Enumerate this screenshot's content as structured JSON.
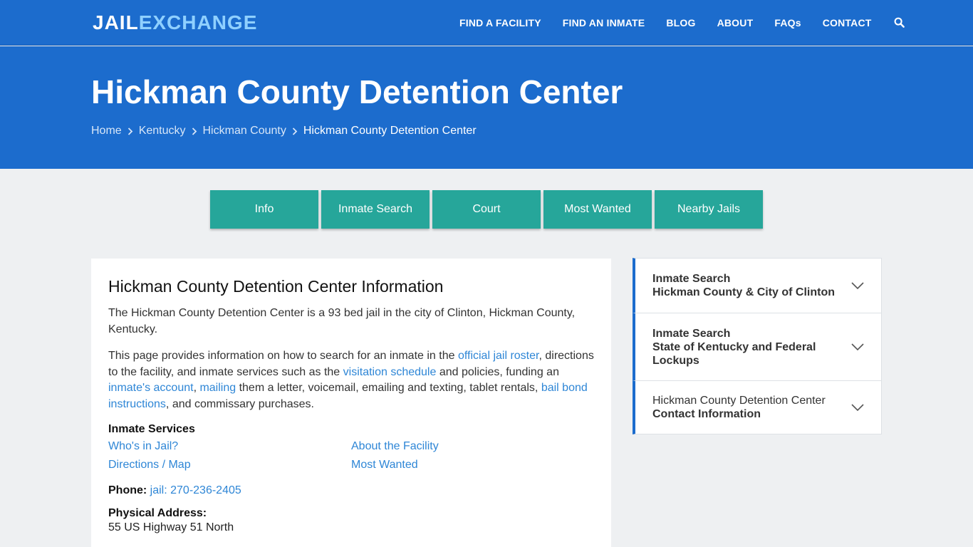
{
  "logo": {
    "part1": "JAIL",
    "part2": "EXCHANGE"
  },
  "nav": {
    "find_facility": "FIND A FACILITY",
    "find_inmate": "FIND AN INMATE",
    "blog": "BLOG",
    "about": "ABOUT",
    "faqs": "FAQs",
    "contact": "CONTACT"
  },
  "hero": {
    "title": "Hickman County Detention Center",
    "breadcrumb": [
      "Home",
      "Kentucky",
      "Hickman County",
      "Hickman County Detention Center"
    ]
  },
  "tabs": [
    "Info",
    "Inmate Search",
    "Court",
    "Most Wanted",
    "Nearby Jails"
  ],
  "main": {
    "heading": "Hickman County Detention Center Information",
    "p1": "The Hickman County Detention Center is a 93 bed jail in the city of Clinton, Hickman County, Kentucky.",
    "p2": {
      "t1": "This page provides information on how to search for an inmate in the ",
      "l1": "official jail roster",
      "t2": ", directions to the facility, and inmate services such as the ",
      "l2": "visitation schedule",
      "t3": " and policies, funding an ",
      "l3": "inmate's account",
      "t4": ", ",
      "l4": "mailing",
      "t5": " them a letter, voicemail, emailing and texting, tablet rentals, ",
      "l5": "bail bond instructions",
      "t6": ", and commissary purchases."
    },
    "services_title": "Inmate Services",
    "services": [
      "Who's in Jail?",
      "About the Facility",
      "Directions / Map",
      "Most Wanted"
    ],
    "phone_label": "Phone:",
    "phone_value": "jail: 270-236-2405",
    "address_label": "Physical Address:",
    "address_line1": "55 US Highway 51 North"
  },
  "sidebar": [
    {
      "line1": "Inmate Search",
      "line2": "Hickman County & City of Clinton"
    },
    {
      "line1": "Inmate Search",
      "line2": "State of Kentucky and Federal Lockups"
    },
    {
      "line1": "Hickman County Detention Center",
      "line2": "Contact Information"
    }
  ],
  "colors": {
    "brand_blue": "#1c6ccd",
    "teal": "#26a69a",
    "link": "#2e86d6"
  }
}
